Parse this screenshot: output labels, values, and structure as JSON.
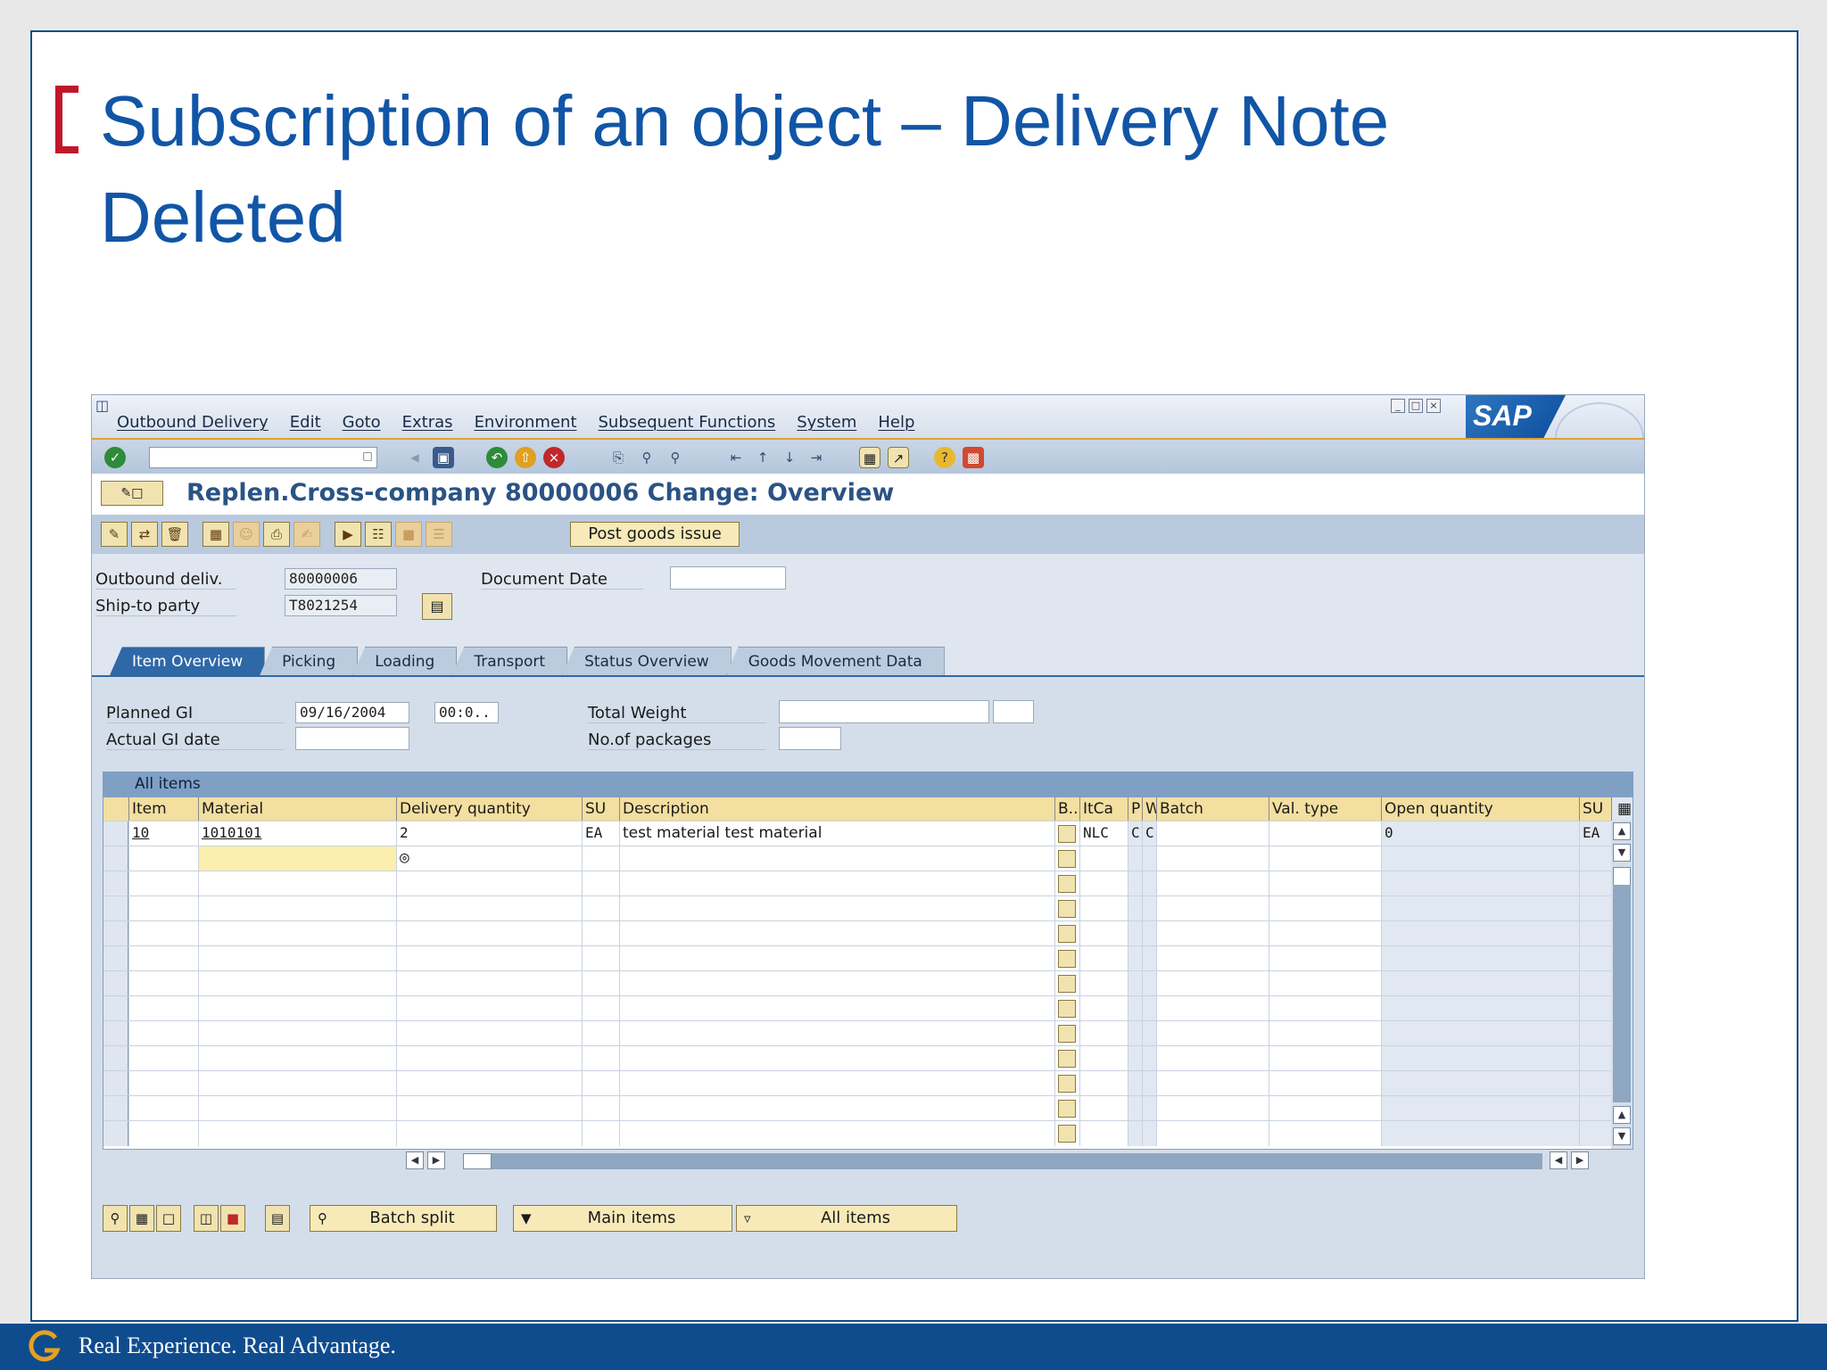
{
  "slide": {
    "title_line1": "Subscription of an object – Delivery Note",
    "title_line2": "Deleted",
    "footer_text": "Real Experience. Real Advantage.",
    "colors": {
      "brand_blue": "#0f4c8e",
      "title_blue": "#1155a6",
      "bracket_red": "#c0172b"
    }
  },
  "sap": {
    "menu": [
      "Outbound Delivery",
      "Edit",
      "Goto",
      "Extras",
      "Environment",
      "Subsequent Functions",
      "System",
      "Help"
    ],
    "logo_text": "SAP",
    "command_field": {
      "value": ""
    },
    "screen_title": "Replen.Cross-company 80000006 Change: Overview",
    "post_goods_issue_label": "Post goods issue",
    "header_fields": {
      "outbound_deliv_label": "Outbound deliv.",
      "outbound_deliv_value": "80000006",
      "ship_to_party_label": "Ship-to party",
      "ship_to_party_value": "T8021254",
      "document_date_label": "Document Date",
      "document_date_value": ""
    },
    "tabs": [
      "Item Overview",
      "Picking",
      "Loading",
      "Transport",
      "Status Overview",
      "Goods Movement Data"
    ],
    "active_tab": "Item Overview",
    "item_overview": {
      "planned_gi_label": "Planned GI",
      "planned_gi_date": "09/16/2004",
      "planned_gi_time": "00:0..",
      "actual_gi_date_label": "Actual GI date",
      "actual_gi_date_value": "",
      "total_weight_label": "Total Weight",
      "total_weight_value": "",
      "packages_label": "No.of packages",
      "packages_value": ""
    },
    "table": {
      "group_title": "All items",
      "columns": [
        "Item",
        "Material",
        "Delivery quantity",
        "SU",
        "Description",
        "B..",
        "ItCa",
        "P",
        "W",
        "Batch",
        "Val. type",
        "Open quantity",
        "SU"
      ],
      "rows": [
        {
          "item": "10",
          "material": "1010101",
          "delivery_quantity": "2",
          "su": "EA",
          "description": "test material test material",
          "itca": "NLC",
          "p": "C",
          "w": "C",
          "batch": "",
          "val_type": "",
          "open_quantity": "0",
          "su2": "EA"
        }
      ],
      "empty_row_count": 12
    },
    "bottom_buttons": {
      "batch_split": "Batch split",
      "main_items": "Main items",
      "all_items": "All items"
    },
    "icons": {
      "enter": "check-icon",
      "save": "save-icon",
      "back": "back-icon",
      "exit": "exit-icon",
      "cancel": "cancel-icon",
      "print": "print-icon",
      "find": "find-icon",
      "help": "help-icon"
    }
  }
}
